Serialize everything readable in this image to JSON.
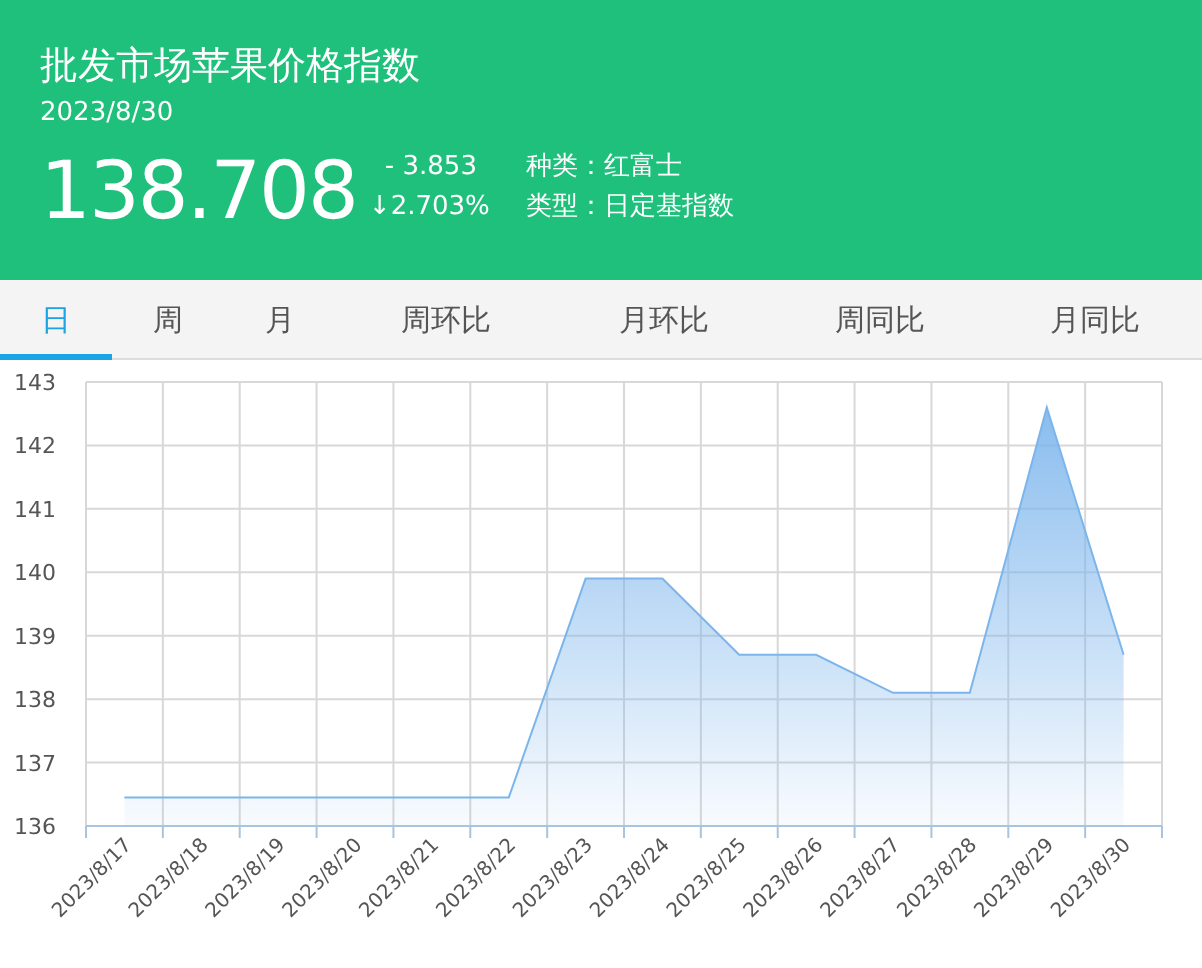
{
  "header": {
    "title": "批发市场苹果价格指数",
    "date": "2023/8/30",
    "value": "138.708",
    "change": "- 3.853",
    "change_percent": "↓2.703%",
    "variety": "种类：红富士",
    "index_type": "类型：日定基指数"
  },
  "tabs": [
    {
      "label": "日",
      "selected": true
    },
    {
      "label": "周",
      "selected": false
    },
    {
      "label": "月",
      "selected": false
    },
    {
      "label": "周环比",
      "selected": false
    },
    {
      "label": "月环比",
      "selected": false
    },
    {
      "label": "周同比",
      "selected": false
    },
    {
      "label": "月同比",
      "selected": false
    }
  ],
  "chart": {
    "chart_data": {
      "type": "area",
      "categories": [
        "2023/8/17",
        "2023/8/18",
        "2023/8/19",
        "2023/8/20",
        "2023/8/21",
        "2023/8/22",
        "2023/8/23",
        "2023/8/24",
        "2023/8/25",
        "2023/8/26",
        "2023/8/27",
        "2023/8/28",
        "2023/8/29",
        "2023/8/30"
      ],
      "series": [
        {
          "color": "#7cb5ec",
          "values": [
            136.45,
            136.45,
            136.45,
            136.45,
            136.45,
            136.45,
            139.9,
            139.9,
            138.7,
            138.7,
            138.1,
            138.1,
            142.6,
            138.7
          ]
        }
      ],
      "grid": true,
      "ylim": [
        136,
        143
      ],
      "yticks": [
        136,
        137,
        138,
        139,
        140,
        141,
        142,
        143
      ]
    }
  }
}
